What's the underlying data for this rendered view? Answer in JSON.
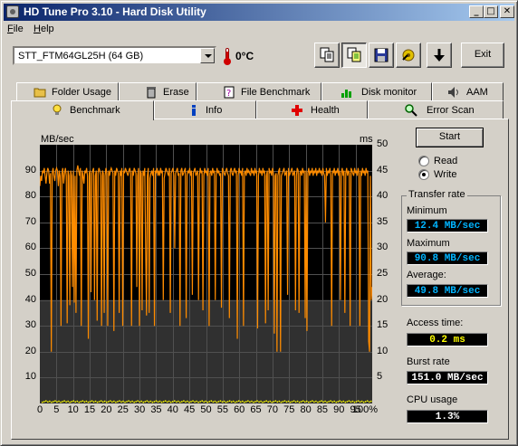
{
  "window": {
    "title": "HD Tune Pro 3.10 - Hard Disk Utility"
  },
  "titlebar_buttons": {
    "minimize": "_",
    "maximize": "□",
    "close": "✕"
  },
  "menu": [
    "File",
    "Help"
  ],
  "toolbar": {
    "drive": "STT_FTM64GL25H (64 GB)",
    "temperature": "0°C",
    "exit_label": "Exit",
    "icons": [
      "copy-icon",
      "copy-all-icon",
      "save-icon",
      "options-icon",
      "download-icon"
    ]
  },
  "tabs_row1": [
    "Folder Usage",
    "Erase",
    "File Benchmark",
    "Disk monitor",
    "AAM"
  ],
  "tabs_row2": [
    "Benchmark",
    "Info",
    "Health",
    "Error Scan"
  ],
  "active_tab": "Benchmark",
  "controls": {
    "start_label": "Start",
    "read_label": "Read",
    "write_label": "Write",
    "selected_mode": "Write"
  },
  "results": {
    "transfer_rate_label": "Transfer rate",
    "minimum_label": "Minimum",
    "minimum": "12.4 MB/sec",
    "maximum_label": "Maximum",
    "maximum": "90.8 MB/sec",
    "average_label": "Average:",
    "average": "49.8 MB/sec",
    "access_time_label": "Access time:",
    "access_time": "0.2 ms",
    "burst_rate_label": "Burst rate",
    "burst_rate": "151.0 MB/sec",
    "cpu_usage_label": "CPU usage",
    "cpu_usage": "1.3%"
  },
  "colors": {
    "transfer_line": "#ff8c00",
    "access_points": "#ffff00",
    "chart_bg": "#000000",
    "grid": "#505050",
    "shade": "#303030"
  },
  "chart_data": {
    "type": "line",
    "ylabel_left": "MB/sec",
    "ylabel_right": "ms",
    "ylim_left": [
      0,
      100
    ],
    "ylim_right": [
      0,
      50
    ],
    "xlim": [
      0,
      100
    ],
    "left_ticks": [
      "10",
      "20",
      "30",
      "40",
      "50",
      "60",
      "70",
      "80",
      "90"
    ],
    "right_ticks": [
      "5",
      "10",
      "15",
      "20",
      "25",
      "30",
      "35",
      "40",
      "45",
      "50"
    ],
    "x_ticks": [
      "0",
      "5",
      "10",
      "15",
      "20",
      "25",
      "30",
      "35",
      "40",
      "45",
      "50",
      "55",
      "60",
      "65",
      "70",
      "75",
      "80",
      "85",
      "90",
      "95",
      "100%"
    ],
    "grid": true,
    "series": [
      {
        "values": [
          84,
          88,
          86,
          90,
          89,
          91,
          88,
          85,
          89,
          91,
          90,
          85,
          89,
          20,
          89,
          91,
          88,
          86,
          90,
          91,
          90,
          84,
          90,
          88,
          30,
          89,
          91,
          85,
          89,
          91,
          88,
          31,
          90,
          88,
          38,
          90,
          88,
          45,
          90,
          39,
          88,
          35,
          90,
          92,
          90,
          88,
          91,
          30,
          90,
          88,
          85,
          90,
          89,
          91,
          88,
          25,
          89,
          90,
          43,
          89,
          90,
          91,
          40,
          88,
          90,
          32,
          89,
          91,
          90,
          88,
          30,
          90,
          89,
          35,
          88,
          91,
          89,
          30,
          90,
          88,
          90,
          91,
          90,
          89,
          28,
          90,
          88,
          91,
          90,
          89,
          35,
          90,
          88,
          91,
          30,
          90,
          89,
          91,
          90,
          89,
          88,
          90,
          91,
          89,
          30,
          90,
          88,
          91,
          90,
          89,
          45,
          88,
          91,
          30,
          90,
          89,
          36,
          90,
          88,
          91,
          60,
          34,
          88,
          91,
          35,
          87,
          89,
          90,
          88,
          91,
          30,
          90,
          89,
          91,
          88,
          90,
          88,
          91,
          89,
          90,
          40,
          87,
          89,
          91,
          90,
          89,
          88,
          91,
          35,
          89,
          90,
          91,
          88,
          60,
          89,
          90,
          91,
          88,
          89,
          30,
          90,
          91,
          88,
          89,
          90,
          91,
          33,
          88,
          90,
          89,
          91,
          88,
          90,
          42,
          89,
          90,
          91,
          88,
          89,
          90,
          40,
          88,
          91,
          89,
          90,
          36,
          88,
          91,
          89,
          90,
          88,
          91,
          30,
          89,
          90,
          88,
          91,
          89,
          90,
          40,
          88,
          91,
          89,
          90,
          88,
          89,
          37,
          91,
          90,
          89,
          88,
          90,
          91,
          89,
          88,
          33,
          90,
          91,
          89,
          88,
          90,
          91,
          89,
          90,
          25,
          88,
          91,
          89,
          90,
          88,
          91,
          30,
          89,
          90,
          88,
          91,
          89,
          90,
          89,
          88,
          91,
          89,
          90,
          88,
          91,
          89,
          90,
          29,
          88,
          91,
          89,
          90,
          88,
          91,
          89,
          90,
          31,
          88,
          90,
          36,
          91,
          89,
          90,
          88,
          91,
          89,
          27,
          88,
          89,
          20,
          88,
          90,
          91,
          20,
          88,
          89,
          90,
          91,
          88,
          89,
          90,
          42,
          91,
          88,
          89,
          90,
          91,
          88,
          89,
          90,
          36,
          88,
          91,
          90,
          35,
          89,
          90,
          88,
          91,
          89,
          90,
          33,
          90,
          28,
          89,
          91,
          88,
          90,
          89,
          91,
          88,
          90,
          89,
          91,
          88,
          90,
          89,
          91,
          89,
          90,
          88,
          91,
          89,
          88,
          70,
          91,
          88,
          90,
          89,
          91,
          88,
          30,
          90,
          89,
          91,
          88,
          90,
          89,
          91,
          88,
          90,
          40,
          89,
          91,
          88,
          90,
          35,
          89,
          91,
          88,
          90,
          89,
          30,
          91,
          90,
          89,
          88,
          91,
          89,
          90,
          88,
          91,
          89,
          30,
          90,
          88,
          91,
          89,
          90,
          88,
          91,
          89,
          90,
          24,
          20,
          88,
          40,
          45
        ]
      }
    ]
  }
}
